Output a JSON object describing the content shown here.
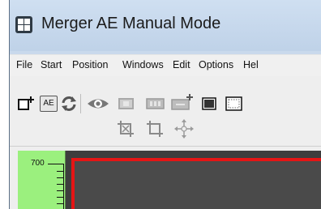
{
  "window": {
    "title": "Merger AE Manual Mode"
  },
  "menubar": {
    "items": [
      "File",
      "Start",
      "Position",
      "Windows",
      "Edit",
      "Options",
      "Hel"
    ]
  },
  "toolbar": {
    "row1": [
      {
        "icon": "new-document-icon"
      },
      {
        "icon": "ae-mode-icon",
        "label": "AE"
      },
      {
        "icon": "refresh-icon"
      },
      {
        "icon": "eye-icon"
      },
      {
        "icon": "frame-icon"
      },
      {
        "icon": "filmstrip-icon"
      },
      {
        "icon": "add-film-icon"
      },
      {
        "icon": "filled-square-icon"
      },
      {
        "icon": "dotted-square-icon"
      }
    ],
    "row2": [
      {
        "icon": "crop-x-icon"
      },
      {
        "icon": "crop-icon"
      },
      {
        "icon": "move-icon"
      }
    ]
  },
  "ruler": {
    "label": "700"
  },
  "colors": {
    "ruler_bg": "#9bf07e",
    "frame_border": "#e51515",
    "canvas_bg": "#3d3d3d"
  }
}
